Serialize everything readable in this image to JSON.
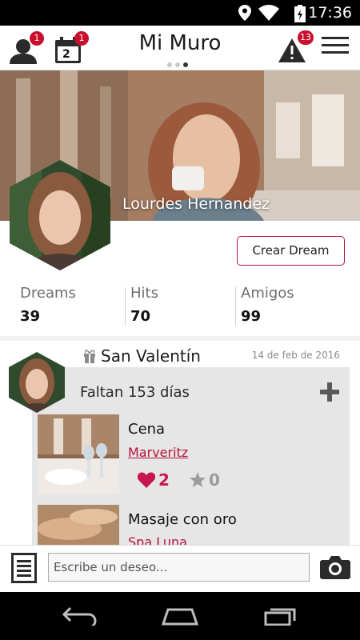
{
  "status_bar": {
    "time": "17:36",
    "icons": [
      "location-icon",
      "wifi-icon",
      "battery-icon"
    ]
  },
  "header": {
    "title": "Mi Muro",
    "friends_badge": "1",
    "calendar_badge": "1",
    "calendar_day": "2",
    "alerts_badge": "13",
    "page_indicator": {
      "count": 3,
      "active": 3
    }
  },
  "profile": {
    "name": "Lourdes Hernandez",
    "create_button": "Crear Dream"
  },
  "stats": [
    {
      "label": "Dreams",
      "value": "39"
    },
    {
      "label": "Hits",
      "value": "70"
    },
    {
      "label": "Amigos",
      "value": "99"
    }
  ],
  "event": {
    "title": "San Valentín",
    "date": "14 de feb de 2016",
    "countdown": "Faltan 153 días",
    "wishes": [
      {
        "title": "Cena",
        "shop": "Marveritz",
        "likes": "2",
        "stars": "0"
      },
      {
        "title": "Masaje con oro",
        "shop": "Spa Luna"
      }
    ]
  },
  "input_bar": {
    "placeholder": "Escribe un deseo..."
  },
  "colors": {
    "accent": "#c8102e",
    "like": "#c8174d",
    "panel": "#e6e6e6"
  }
}
